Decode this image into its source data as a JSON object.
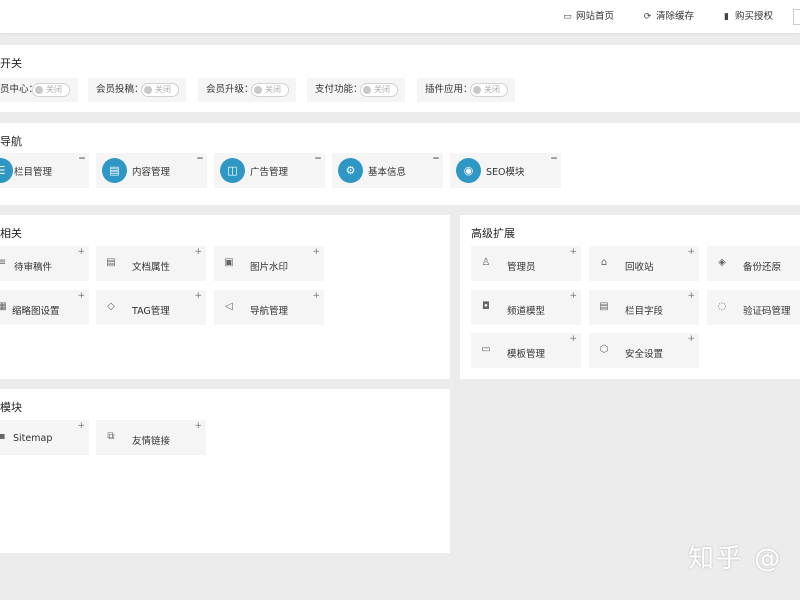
{
  "top_links": [
    {
      "icon": "monitor-icon",
      "glyph": "▭",
      "label": "网站首页"
    },
    {
      "icon": "refresh-icon",
      "glyph": "⟳",
      "label": "清除缓存"
    },
    {
      "icon": "bookmark-icon",
      "glyph": "▮",
      "label": "购买授权"
    }
  ],
  "switches_panel": {
    "title": "开关",
    "items": [
      {
        "label": "员中心：",
        "state": "关闭"
      },
      {
        "label": "会员投稿：",
        "state": "关闭"
      },
      {
        "label": "会员升级：",
        "state": "关闭"
      },
      {
        "label": "支付功能：",
        "state": "关闭"
      },
      {
        "label": "插件应用：",
        "state": "关闭"
      }
    ]
  },
  "nav_panel": {
    "title": "导航",
    "items": [
      {
        "label": "栏目管理",
        "icon": "column-icon",
        "glyph": "☰",
        "collapse": "−"
      },
      {
        "label": "内容管理",
        "icon": "document-icon",
        "glyph": "▤",
        "collapse": "−"
      },
      {
        "label": "广告管理",
        "icon": "ad-icon",
        "glyph": "◫",
        "collapse": "−"
      },
      {
        "label": "基本信息",
        "icon": "gear-icon",
        "glyph": "⚙",
        "collapse": "−"
      },
      {
        "label": "SEO模块",
        "icon": "seo-icon",
        "glyph": "◉",
        "collapse": "−"
      }
    ]
  },
  "content_panel": {
    "title": "相关",
    "items": [
      {
        "label": "待审稿件",
        "icon": "list-icon",
        "glyph": "≡",
        "add": "+"
      },
      {
        "label": "文档属性",
        "icon": "doc-icon",
        "glyph": "▤",
        "add": "+"
      },
      {
        "label": "图片水印",
        "icon": "image-icon",
        "glyph": "▣",
        "add": "+"
      },
      {
        "label": "缩略图设置",
        "icon": "thumbnail-icon",
        "glyph": "▦",
        "add": "+"
      },
      {
        "label": "TAG管理",
        "icon": "tag-icon",
        "glyph": "◇",
        "add": "+"
      },
      {
        "label": "导航管理",
        "icon": "navigation-icon",
        "glyph": "◁",
        "add": "+"
      }
    ]
  },
  "advanced_panel": {
    "title": "高级扩展",
    "items": [
      {
        "label": "管理员",
        "icon": "user-icon",
        "glyph": "♙",
        "add": "+"
      },
      {
        "label": "回收站",
        "icon": "recycle-icon",
        "glyph": "⌂",
        "add": "+"
      },
      {
        "label": "备份还原",
        "icon": "backup-icon",
        "glyph": "◈",
        "add": "+"
      },
      {
        "label": "频道模型",
        "icon": "tv-icon",
        "glyph": "◘",
        "add": "+"
      },
      {
        "label": "栏目字段",
        "icon": "field-icon",
        "glyph": "▤",
        "add": "+"
      },
      {
        "label": "验证码管理",
        "icon": "shield-icon",
        "glyph": "◌",
        "add": "+"
      },
      {
        "label": "模板管理",
        "icon": "template-icon",
        "glyph": "▭",
        "add": "+"
      },
      {
        "label": "安全设置",
        "icon": "security-icon",
        "glyph": "⬡",
        "add": "+"
      }
    ]
  },
  "modules_panel": {
    "title": "模块",
    "items": [
      {
        "label": "Sitemap",
        "icon": "sitemap-icon",
        "glyph": "▪",
        "add": "+"
      },
      {
        "label": "友情链接",
        "icon": "link-icon",
        "glyph": "⧉",
        "add": "+"
      }
    ]
  },
  "watermark": "知乎 @"
}
